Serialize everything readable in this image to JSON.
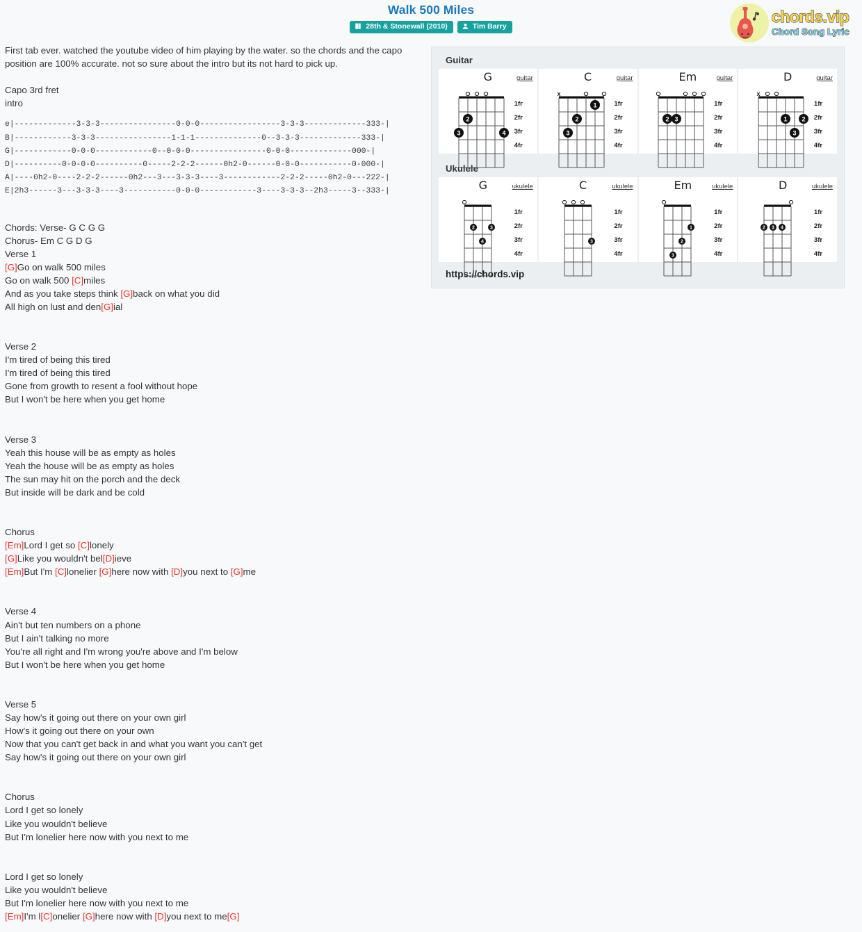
{
  "header": {
    "title": "Walk 500 Miles",
    "album_badge": "28th & Stonewall (2010)",
    "artist_badge": "Tim Barry",
    "album_icon": "book-icon",
    "artist_icon": "user-icon"
  },
  "logo": {
    "main": "chords.vip",
    "sub": "Chord Song Lyric",
    "icon": "guitar-icon"
  },
  "intro_note": "First tab ever. watched the youtube video of him playing by the water. so the chords and the capo position are 100% accurate. not so sure about the intro but its not hard to pick up.",
  "capo_block": "Capo 3rd fret\nintro",
  "tab": "e|-------------3-3-3----------------0-0-0-----------------3-3-3-------------333-|\nB|------------3-3-3----------------1-1-1--------------0--3-3-3-------------333-|\nG|------------0-0-0------------0--0-0-0----------------0-0-0-------------000-|\nD|----------0-0-0-0----------0-----2-2-2------0h2-0------0-0-0-----------0-000-|\nA|----0h2-0----2-2-2------0h2---3---3-3-3----3------------2-2-2-----0h2-0---222-|\nE|2h3------3---3-3-3----3-----------0-0-0------------3----3-3-3--2h3-----3--333-|",
  "chords_summary": "Chords: Verse- G C G G\nChorus- Em C G D G",
  "sections": [
    {
      "name": "verse-1",
      "heading": "Verse 1",
      "lines": [
        [
          {
            "c": "[G]"
          },
          {
            "t": "Go on walk 500 miles"
          }
        ],
        [
          {
            "t": "Go on walk 500 "
          },
          {
            "c": "[C]"
          },
          {
            "t": "miles"
          }
        ],
        [
          {
            "t": "And as you take steps think "
          },
          {
            "c": "[G]"
          },
          {
            "t": "back on what you did"
          }
        ],
        [
          {
            "t": "All high on lust and den"
          },
          {
            "c": "[G]"
          },
          {
            "t": "ial"
          }
        ]
      ]
    },
    {
      "name": "verse-2",
      "heading": "Verse 2",
      "lines": [
        [
          {
            "t": "I'm tired of being this tired"
          }
        ],
        [
          {
            "t": "I'm tired of being this tired"
          }
        ],
        [
          {
            "t": "Gone from growth to resent a fool without hope"
          }
        ],
        [
          {
            "t": "But I won't be here when you get home"
          }
        ]
      ]
    },
    {
      "name": "verse-3",
      "heading": "Verse 3",
      "lines": [
        [
          {
            "t": "Yeah this house will be as empty as holes"
          }
        ],
        [
          {
            "t": "Yeah the house will be as empty as holes"
          }
        ],
        [
          {
            "t": "The sun may hit on the porch and the deck"
          }
        ],
        [
          {
            "t": "But inside will be dark and be cold"
          }
        ]
      ]
    },
    {
      "name": "chorus-1",
      "heading": "Chorus",
      "lines": [
        [
          {
            "c": "[Em]"
          },
          {
            "t": "Lord I get so "
          },
          {
            "c": "[C]"
          },
          {
            "t": "lonely"
          }
        ],
        [
          {
            "c": "[G]"
          },
          {
            "t": "Like you wouldn't bel"
          },
          {
            "c": "[D]"
          },
          {
            "t": "ieve"
          }
        ],
        [
          {
            "c": "[Em]"
          },
          {
            "t": "But I'm "
          },
          {
            "c": "[C]"
          },
          {
            "t": "lonelier "
          },
          {
            "c": "[G]"
          },
          {
            "t": "here now with "
          },
          {
            "c": "[D]"
          },
          {
            "t": "you next to "
          },
          {
            "c": "[G]"
          },
          {
            "t": "me"
          }
        ]
      ]
    },
    {
      "name": "verse-4",
      "heading": "Verse 4",
      "lines": [
        [
          {
            "t": "Ain't but ten numbers on a phone"
          }
        ],
        [
          {
            "t": "But I ain't talking no more"
          }
        ],
        [
          {
            "t": "You're all right and I'm wrong you're above and I'm below"
          }
        ],
        [
          {
            "t": "But I won't be here when you get home"
          }
        ]
      ]
    },
    {
      "name": "verse-5",
      "heading": "Verse 5",
      "lines": [
        [
          {
            "t": "Say how's it going out there on your own girl"
          }
        ],
        [
          {
            "t": "How's it going out there on your own"
          }
        ],
        [
          {
            "t": "Now that you can't get back in and what you want you can't get"
          }
        ],
        [
          {
            "t": "Say how's it going out there on your own girl"
          }
        ]
      ]
    },
    {
      "name": "chorus-2",
      "heading": "Chorus",
      "lines": [
        [
          {
            "t": "Lord I get so lonely"
          }
        ],
        [
          {
            "t": "Like you wouldn't believe"
          }
        ],
        [
          {
            "t": "But I'm lonelier here now with you next to me"
          }
        ]
      ]
    },
    {
      "name": "chorus-3",
      "heading": "",
      "lines": [
        [
          {
            "t": "Lord I get so lonely"
          }
        ],
        [
          {
            "t": "Like you wouldn't believe"
          }
        ],
        [
          {
            "t": "But I'm lonelier here now with you next to me"
          }
        ],
        [
          {
            "c": "[Em]"
          },
          {
            "t": "I'm l"
          },
          {
            "c": "[C]"
          },
          {
            "t": "onelier "
          },
          {
            "c": "[G]"
          },
          {
            "t": "here now with "
          },
          {
            "c": "[D]"
          },
          {
            "t": "you next to me"
          },
          {
            "c": "[G]"
          }
        ]
      ]
    }
  ],
  "instruments": [
    {
      "title": "Guitar",
      "label": "guitar",
      "strings": 6,
      "frets": 4,
      "fret_labels": [
        "1fr",
        "2fr",
        "3fr",
        "4fr"
      ],
      "diagrams": [
        {
          "name": "G",
          "top": [
            "",
            "o",
            "o",
            "o",
            "",
            ""
          ],
          "dots": [
            {
              "string": 6,
              "fret": 3,
              "finger": "3"
            },
            {
              "string": 5,
              "fret": 2,
              "finger": "2"
            },
            {
              "string": 1,
              "fret": 3,
              "finger": "4"
            }
          ]
        },
        {
          "name": "C",
          "top": [
            "x",
            "",
            "",
            "o",
            "",
            "o"
          ],
          "dots": [
            {
              "string": 5,
              "fret": 3,
              "finger": "3"
            },
            {
              "string": 4,
              "fret": 2,
              "finger": "2"
            },
            {
              "string": 2,
              "fret": 1,
              "finger": "1"
            }
          ]
        },
        {
          "name": "Em",
          "top": [
            "o",
            "",
            "",
            "o",
            "o",
            "o"
          ],
          "dots": [
            {
              "string": 5,
              "fret": 2,
              "finger": "2"
            },
            {
              "string": 4,
              "fret": 2,
              "finger": "3"
            }
          ]
        },
        {
          "name": "D",
          "top": [
            "x",
            "o",
            "o",
            "",
            "",
            ""
          ],
          "dots": [
            {
              "string": 3,
              "fret": 2,
              "finger": "1"
            },
            {
              "string": 1,
              "fret": 2,
              "finger": "2"
            },
            {
              "string": 2,
              "fret": 3,
              "finger": "3"
            }
          ]
        }
      ]
    },
    {
      "title": "Ukulele",
      "label": "ukulele",
      "strings": 4,
      "frets": 4,
      "fret_labels": [
        "1fr",
        "2fr",
        "3fr",
        "4fr"
      ],
      "diagrams": [
        {
          "name": "G",
          "top": [
            "o",
            "",
            "",
            ""
          ],
          "dots": [
            {
              "string": 3,
              "fret": 2,
              "finger": "2"
            },
            {
              "string": 1,
              "fret": 2,
              "finger": "3"
            },
            {
              "string": 2,
              "fret": 3,
              "finger": "4"
            }
          ]
        },
        {
          "name": "C",
          "top": [
            "o",
            "o",
            "o",
            ""
          ],
          "dots": [
            {
              "string": 1,
              "fret": 3,
              "finger": "3"
            }
          ]
        },
        {
          "name": "Em",
          "top": [
            "o",
            "",
            "",
            ""
          ],
          "dots": [
            {
              "string": 1,
              "fret": 2,
              "finger": "1"
            },
            {
              "string": 2,
              "fret": 3,
              "finger": "2"
            },
            {
              "string": 3,
              "fret": 4,
              "finger": "3"
            }
          ]
        },
        {
          "name": "D",
          "top": [
            "",
            "",
            "",
            "o"
          ],
          "dots": [
            {
              "string": 4,
              "fret": 2,
              "finger": "2"
            },
            {
              "string": 3,
              "fret": 2,
              "finger": "3"
            },
            {
              "string": 2,
              "fret": 2,
              "finger": "4"
            }
          ]
        }
      ]
    }
  ],
  "site_url": "https://chords.vip"
}
